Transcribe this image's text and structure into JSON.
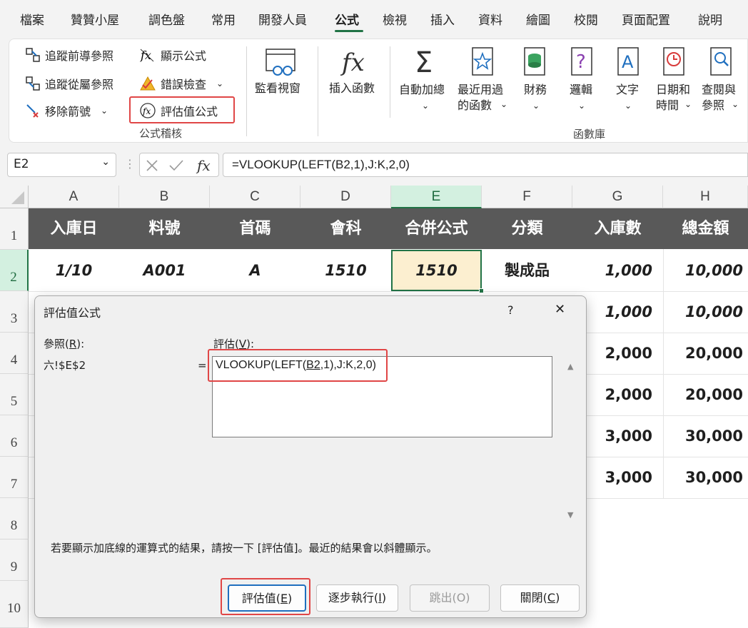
{
  "menu": {
    "tabs": [
      "檔案",
      "贊贊小屋",
      "調色盤",
      "常用",
      "開發人員",
      "公式",
      "檢視",
      "插入",
      "資料",
      "繪圖",
      "校閱",
      "頁面配置",
      "說明"
    ],
    "active": "公式"
  },
  "ribbon": {
    "audit": {
      "trace_precedents": "追蹤前導參照",
      "trace_dependents": "追蹤從屬參照",
      "remove_arrows": "移除箭號",
      "show_formulas": "顯示公式",
      "error_checking": "錯誤檢查",
      "evaluate_formula": "評估值公式",
      "group_label": "公式稽核"
    },
    "watch_window": "監看視窗",
    "insert_function": "插入函數",
    "library": {
      "autosum_line1": "自動加總",
      "recent_line1": "最近用過",
      "recent_line2": "的函數",
      "financial": "財務",
      "logical": "邏輯",
      "text": "文字",
      "datetime_line1": "日期和",
      "datetime_line2": "時間",
      "lookup_line1": "查閱與",
      "lookup_line2": "參照",
      "group_label": "函數庫"
    }
  },
  "formula_bar": {
    "name_box": "E2",
    "formula": "=VLOOKUP(LEFT(B2,1),J:K,2,0)"
  },
  "sheet": {
    "columns": [
      "A",
      "B",
      "C",
      "D",
      "E",
      "F",
      "G",
      "H"
    ],
    "selected_column": "E",
    "rows": [
      "1",
      "2",
      "3",
      "4",
      "5",
      "6",
      "7",
      "8",
      "9",
      "10"
    ],
    "selected_row": "2",
    "headers": [
      "入庫日",
      "料號",
      "首碼",
      "會科",
      "合併公式",
      "分類",
      "入庫數",
      "總金額"
    ],
    "row2": [
      "1/10",
      "A001",
      "A",
      "1510",
      "1510",
      "製成品",
      "1,000",
      "10,000"
    ],
    "visible_g": [
      "1,000",
      "2,000",
      "2,000",
      "3,000",
      "3,000"
    ],
    "visible_h": [
      "10,000",
      "20,000",
      "20,000",
      "30,000",
      "30,000"
    ]
  },
  "dialog": {
    "title": "評估值公式",
    "help": "?",
    "close": "✕",
    "ref_label_pre": "參照(",
    "ref_label_key": "R",
    "ref_label_post": "):",
    "ref_value": "六!$E$2",
    "eval_label_pre": "評估(",
    "eval_label_key": "V",
    "eval_label_post": "):",
    "equals": "=",
    "expr_pre": "VLOOKUP(LEFT(",
    "expr_underlined": "B2",
    "expr_post": ",1),J:K,2,0)",
    "hint": "若要顯示加底線的運算式的結果，請按一下 [評估值]。最近的結果會以斜體顯示。",
    "buttons": {
      "evaluate_pre": "評估值(",
      "evaluate_key": "E",
      "evaluate_post": ")",
      "step_in_pre": "逐步執行(",
      "step_in_key": "I",
      "step_in_post": ")",
      "step_out": "跳出(O)",
      "close_pre": "關閉(",
      "close_key": "C",
      "close_post": ")"
    }
  },
  "colors": {
    "accent": "#217346",
    "highlight": "#e04646",
    "header_fill": "#595959",
    "selected_cell_fill": "#fcefd0"
  }
}
